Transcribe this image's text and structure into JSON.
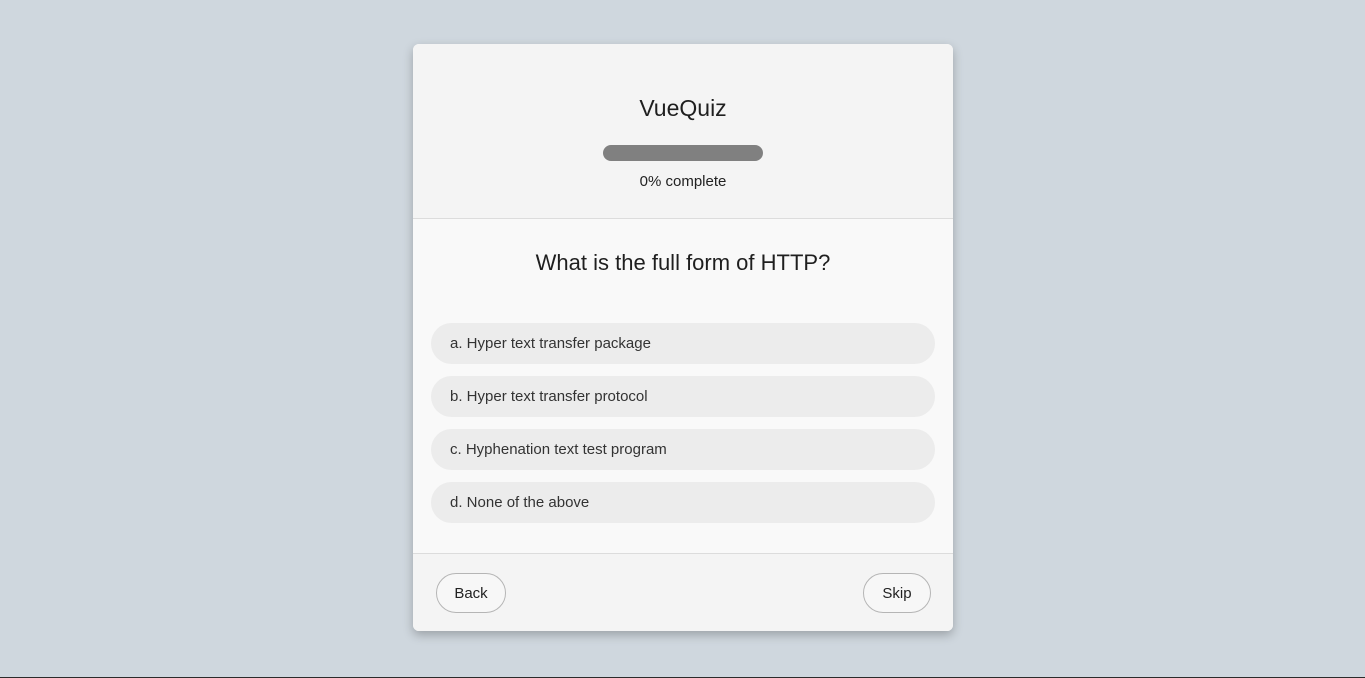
{
  "header": {
    "title": "VueQuiz",
    "progress_percent": 0,
    "progress_text": "0% complete"
  },
  "question": {
    "text": "What is the full form of HTTP?",
    "options": [
      "a. Hyper text transfer package",
      "b. Hyper text transfer protocol",
      "c. Hyphenation text test program",
      "d. None of the above"
    ]
  },
  "footer": {
    "back_label": "Back",
    "skip_label": "Skip"
  }
}
